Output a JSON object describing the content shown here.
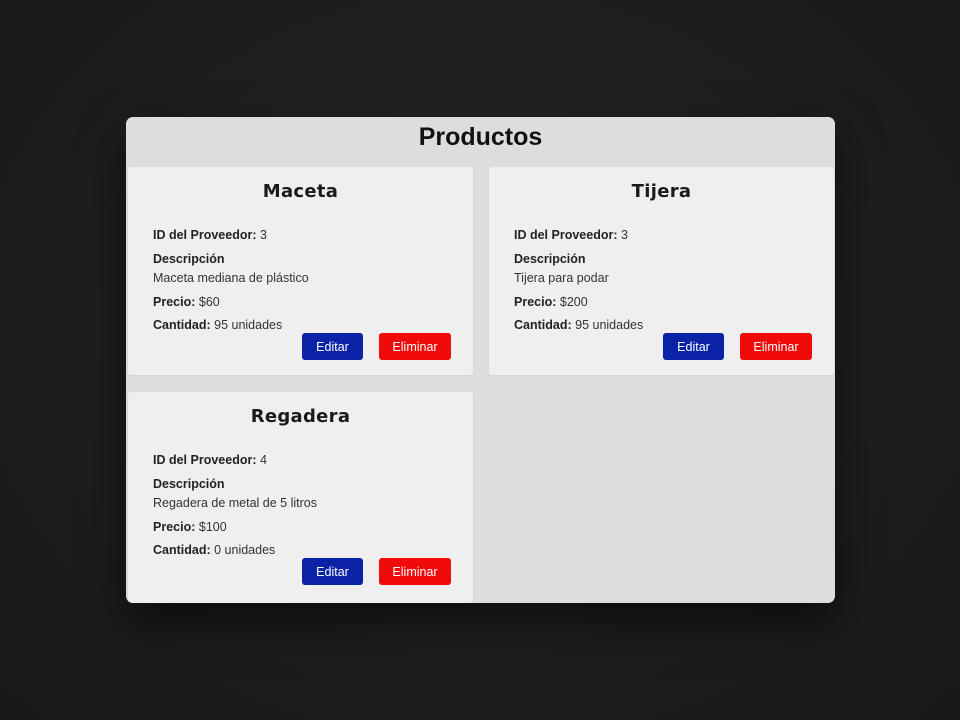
{
  "page": {
    "title": "Productos"
  },
  "labels": {
    "supplier_id": "ID del Proveedor:",
    "description": "Descripción",
    "price": "Precio:",
    "quantity": "Cantidad:"
  },
  "products": [
    {
      "name": "Maceta",
      "supplier_id": "3",
      "description": "Maceta mediana de plástico",
      "price": "$60",
      "quantity": "95 unidades",
      "edit_label": "Editar",
      "delete_label": "Eliminar"
    },
    {
      "name": "Tijera",
      "supplier_id": "3",
      "description": "Tijera para podar",
      "price": "$200",
      "quantity": "95 unidades",
      "edit_label": "Editar",
      "delete_label": "Eliminar"
    },
    {
      "name": "Regadera",
      "supplier_id": "4",
      "description": "Regadera de metal de 5 litros",
      "price": "$100",
      "quantity": "0 unidades",
      "edit_label": "Editar",
      "delete_label": "Eliminar"
    }
  ],
  "colors": {
    "edit_button": "#0a22a6",
    "delete_button": "#f00a0a",
    "card_background": "#efefef",
    "panel_background": "#dddddd"
  }
}
